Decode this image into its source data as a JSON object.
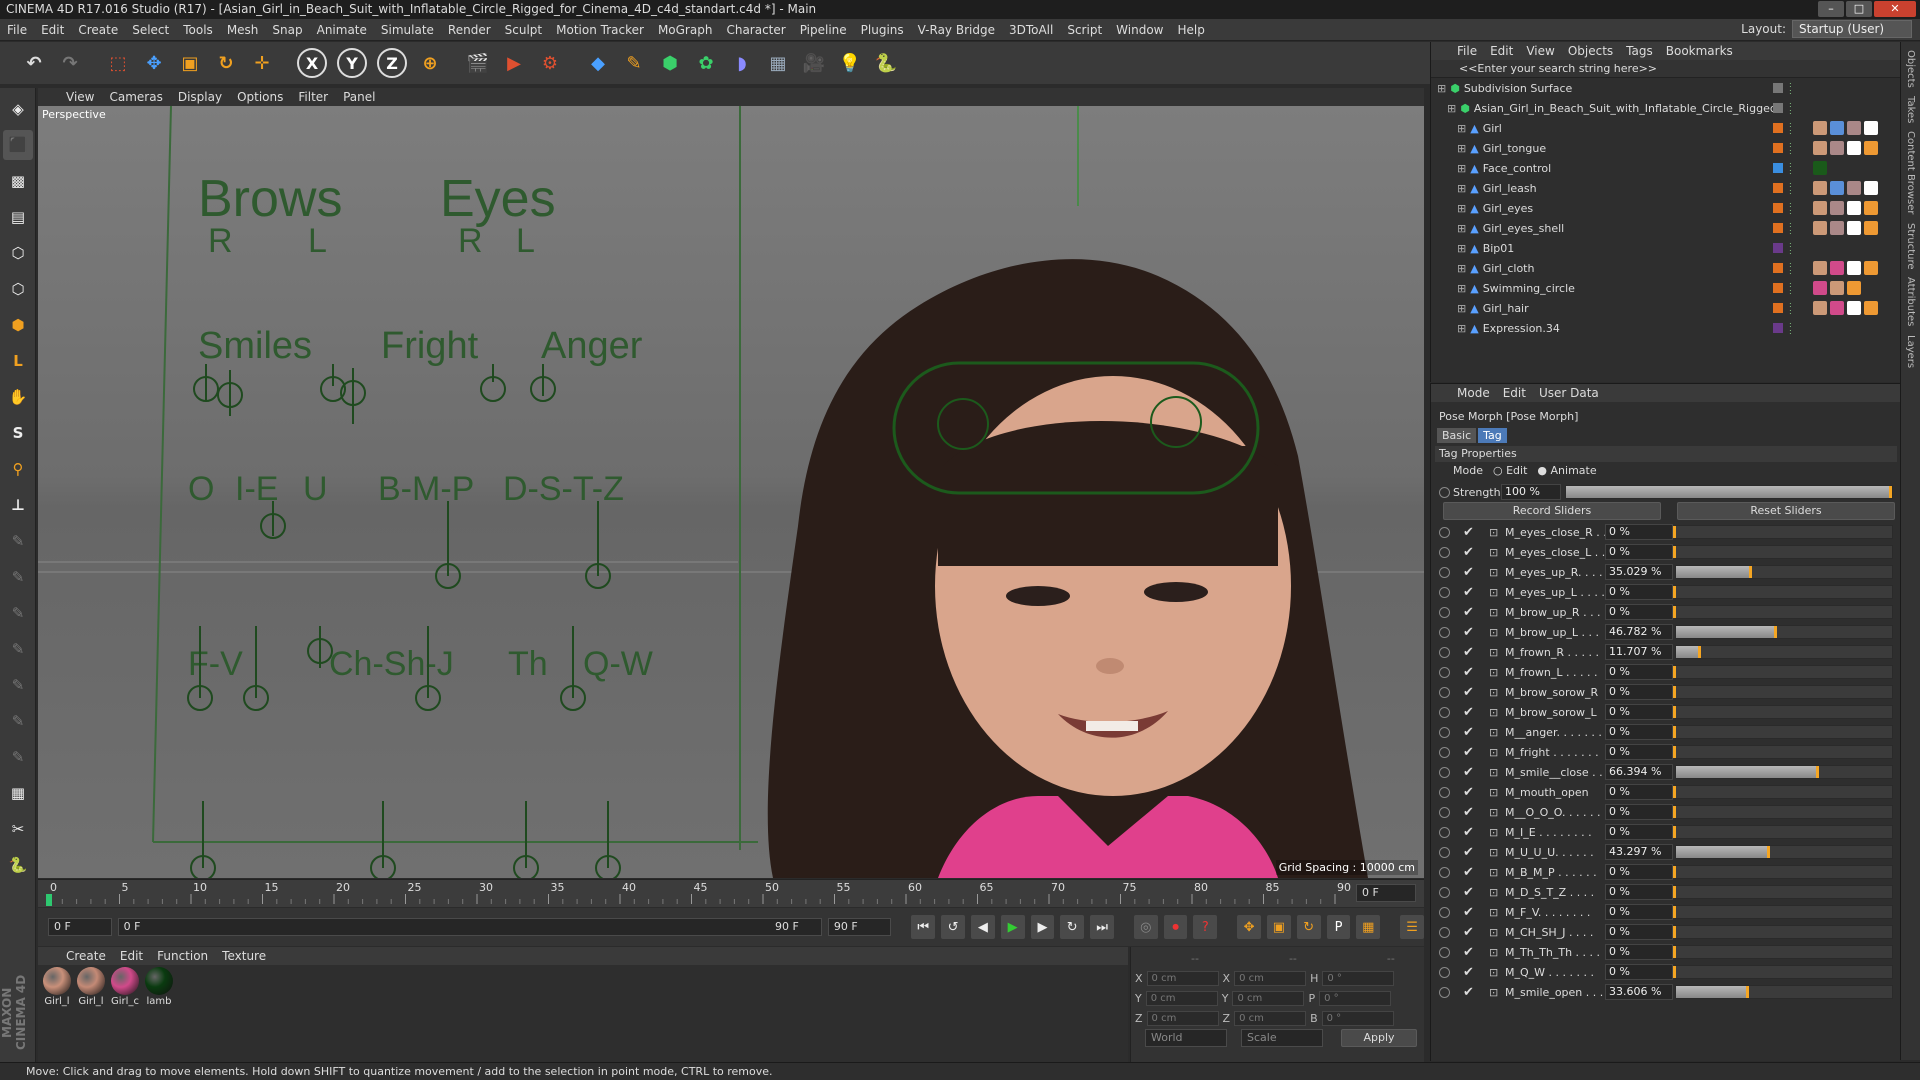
{
  "title": "CINEMA 4D R17.016 Studio (R17) - [Asian_Girl_in_Beach_Suit_with_Inflatable_Circle_Rigged_for_Cinema_4D_c4d_standart.c4d *] - Main",
  "menus": [
    "File",
    "Edit",
    "Create",
    "Select",
    "Tools",
    "Mesh",
    "Snap",
    "Animate",
    "Simulate",
    "Render",
    "Sculpt",
    "Motion Tracker",
    "MoGraph",
    "Character",
    "Pipeline",
    "Plugins",
    "V-Ray Bridge",
    "3DToAll",
    "Script",
    "Window",
    "Help"
  ],
  "layout": {
    "label": "Layout:",
    "value": "Startup (User)"
  },
  "viewport": {
    "menus": [
      "View",
      "Cameras",
      "Display",
      "Options",
      "Filter",
      "Panel"
    ],
    "label": "Perspective",
    "grid": "Grid Spacing : 10000 cm"
  },
  "rig": {
    "brows": "Brows",
    "eyes": "Eyes",
    "r": "R",
    "l": "L",
    "smiles": "Smiles",
    "fright": "Fright",
    "anger": "Anger",
    "o": "O",
    "ie": "I-E",
    "u": "U",
    "bmp": "B-M-P",
    "dstz": "D-S-T-Z",
    "fv": "F-V",
    "chshj": "Ch-Sh-J",
    "th": "Th",
    "qw": "Q-W"
  },
  "timeline": {
    "ticks": [
      "0",
      "5",
      "10",
      "15",
      "20",
      "25",
      "30",
      "35",
      "40",
      "45",
      "50",
      "55",
      "60",
      "65",
      "70",
      "75",
      "80",
      "85",
      "90"
    ],
    "current": "0 F"
  },
  "transport": {
    "start": "0 F",
    "range_start": "0 F",
    "range_end": "90 F",
    "end": "90 F"
  },
  "materials": {
    "menus": [
      "Create",
      "Edit",
      "Function",
      "Texture"
    ],
    "items": [
      {
        "label": "Girl_l",
        "color": "#c9907a"
      },
      {
        "label": "Girl_l",
        "color": "#c48a76"
      },
      {
        "label": "Girl_c",
        "color": "#d14a8a"
      },
      {
        "label": "lamb",
        "color": "#0a3b10"
      }
    ]
  },
  "coords": {
    "x": "X",
    "y": "Y",
    "z": "Z",
    "h": "H",
    "p": "P",
    "b": "B",
    "pos": "0 cm",
    "rot": "0 °",
    "world": "World",
    "scale": "Scale",
    "apply": "Apply",
    "dash": "--"
  },
  "status": "Move: Click and drag to move elements. Hold down SHIFT to quantize movement / add to the selection in point mode, CTRL to remove.",
  "maxon": "MAXON CINEMA 4D",
  "objects": {
    "menus": [
      "File",
      "Edit",
      "View",
      "Objects",
      "Tags",
      "Bookmarks"
    ],
    "search": "<<Enter your search string here>>",
    "rows": [
      {
        "name": "Subdivision Surface",
        "indent": 0,
        "color": "#777"
      },
      {
        "name": "Asian_Girl_in_Beach_Suit_with_Inflatable_Circle_Rigged",
        "indent": 1,
        "color": "#777"
      },
      {
        "name": "Girl",
        "indent": 2,
        "color": "#e07020"
      },
      {
        "name": "Girl_tongue",
        "indent": 2,
        "color": "#e07020"
      },
      {
        "name": "Face_control",
        "indent": 2,
        "color": "#3a8ee0"
      },
      {
        "name": "Girl_leash",
        "indent": 2,
        "color": "#e07020"
      },
      {
        "name": "Girl_eyes",
        "indent": 2,
        "color": "#e07020"
      },
      {
        "name": "Girl_eyes_shell",
        "indent": 2,
        "color": "#e07020"
      },
      {
        "name": "Bip01",
        "indent": 2,
        "color": "#6a3a8a"
      },
      {
        "name": "Girl_cloth",
        "indent": 2,
        "color": "#e07020"
      },
      {
        "name": "Swimming_circle",
        "indent": 2,
        "color": "#e07020"
      },
      {
        "name": "Girl_hair",
        "indent": 2,
        "color": "#e07020"
      },
      {
        "name": "Expression.34",
        "indent": 2,
        "color": "#6a3a8a"
      }
    ]
  },
  "attributes": {
    "menus": [
      "Mode",
      "Edit",
      "User Data"
    ],
    "title": "Pose Morph [Pose Morph]",
    "tabs": [
      "Basic",
      "Tag"
    ],
    "section": "Tag Properties",
    "mode_label": "Mode",
    "mode_edit": "Edit",
    "mode_animate": "Animate",
    "strength_label": "Strength",
    "strength": "100 %",
    "record": "Record Sliders",
    "reset": "Reset Sliders",
    "morphs": [
      {
        "name": "M_eyes_close_R . .",
        "value": "0 %",
        "pct": 0
      },
      {
        "name": "M_eyes_close_L . .",
        "value": "0 %",
        "pct": 0
      },
      {
        "name": "M_eyes_up_R. . . .",
        "value": "35.029 %",
        "pct": 35.029
      },
      {
        "name": "M_eyes_up_L . . . .",
        "value": "0 %",
        "pct": 0
      },
      {
        "name": "M_brow_up_R . . .",
        "value": "0 %",
        "pct": 0
      },
      {
        "name": "M_brow_up_L . . .",
        "value": "46.782 %",
        "pct": 46.782
      },
      {
        "name": "M_frown_R . . . . .",
        "value": "11.707 %",
        "pct": 11.707
      },
      {
        "name": "M_frown_L . . . . .",
        "value": "0 %",
        "pct": 0
      },
      {
        "name": "M_brow_sorow_R",
        "value": "0 %",
        "pct": 0
      },
      {
        "name": "M_brow_sorow_L",
        "value": "0 %",
        "pct": 0
      },
      {
        "name": "M__anger. . . . . . .",
        "value": "0 %",
        "pct": 0
      },
      {
        "name": "M_fright . . . . . . .",
        "value": "0 %",
        "pct": 0
      },
      {
        "name": "M_smile__close . .",
        "value": "66.394 %",
        "pct": 66.394
      },
      {
        "name": "M_mouth_open",
        "value": "0 %",
        "pct": 0
      },
      {
        "name": "M__O_O_O. . . . . .",
        "value": "0 %",
        "pct": 0
      },
      {
        "name": "M_I_E . . . . . . . .",
        "value": "0 %",
        "pct": 0
      },
      {
        "name": "M_U_U_U. . . . . .",
        "value": "43.297 %",
        "pct": 43.297
      },
      {
        "name": "M_B_M_P . . . . . .",
        "value": "0 %",
        "pct": 0
      },
      {
        "name": "M_D_S_T_Z . . . .",
        "value": "0 %",
        "pct": 0
      },
      {
        "name": "M_F_V. . . . . . . .",
        "value": "0 %",
        "pct": 0
      },
      {
        "name": "M_CH_SH_J . . . .",
        "value": "0 %",
        "pct": 0
      },
      {
        "name": "M_Th_Th_Th . . . .",
        "value": "0 %",
        "pct": 0
      },
      {
        "name": "M_Q_W . . . . . . .",
        "value": "0 %",
        "pct": 0
      },
      {
        "name": "M_smile_open . . .",
        "value": "33.606 %",
        "pct": 33.606
      }
    ]
  },
  "sidetabs": [
    "Objects",
    "Takes",
    "Content Browser",
    "Structure",
    "Attributes",
    "Layers"
  ]
}
